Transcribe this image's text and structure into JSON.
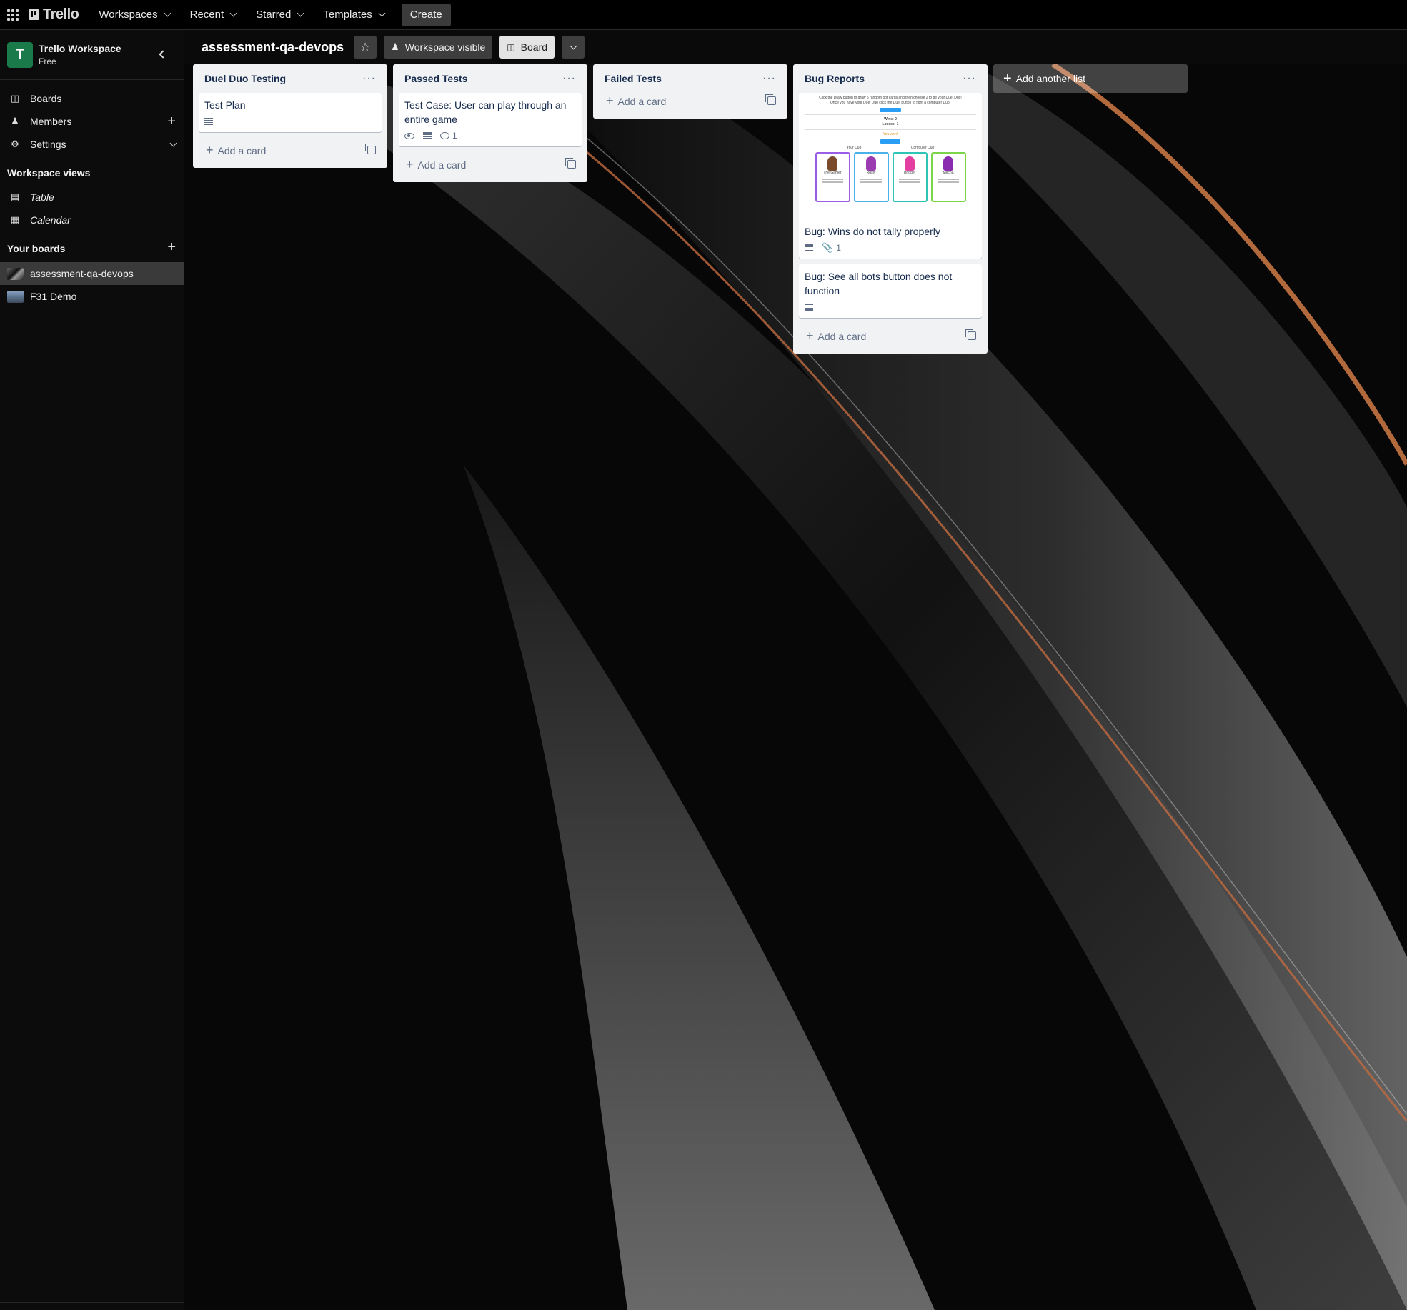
{
  "topnav": {
    "logo": "Trello",
    "items": [
      "Workspaces",
      "Recent",
      "Starred",
      "Templates"
    ],
    "create": "Create"
  },
  "sidebar": {
    "workspace": {
      "initial": "T",
      "name": "Trello Workspace",
      "plan": "Free"
    },
    "nav": [
      "Boards",
      "Members",
      "Settings"
    ],
    "views_heading": "Workspace views",
    "views": [
      "Table",
      "Calendar"
    ],
    "boards_heading": "Your boards",
    "boards": [
      "assessment-qa-devops",
      "F31 Demo"
    ]
  },
  "board": {
    "title": "assessment-qa-devops",
    "visibility": "Workspace visible",
    "view": "Board"
  },
  "lists": [
    {
      "title": "Duel Duo Testing",
      "cards": [
        {
          "title": "Test Plan"
        }
      ],
      "add_card": "Add a card"
    },
    {
      "title": "Passed Tests",
      "cards": [
        {
          "title": "Test Case: User can play through an entire game",
          "comments": "1"
        }
      ],
      "add_card": "Add a card"
    },
    {
      "title": "Failed Tests",
      "cards": [],
      "add_card": "Add a card"
    },
    {
      "title": "Bug Reports",
      "cards": [
        {
          "title": "Bug: Wins do not tally properly",
          "attachments": "1",
          "cover": {
            "line1": "Click the Draw button to draw 5 random bot cards and then choose 2 to be your Duel Duo!",
            "line2": "Once you have your Duel Duo click the Duel button to fight a computer Duo!",
            "button": "See All Bots",
            "wins": "Wins: 0",
            "losses": "Losses: 1",
            "result": "You won!",
            "again": "Play again",
            "your_duo": "Your Duo",
            "computer_duo": "Computer Duo",
            "bots": [
              "The Gamer",
              "Rusty",
              "Bridget",
              "Mecha"
            ]
          }
        },
        {
          "title": "Bug: See all bots button does not function"
        }
      ],
      "add_card": "Add a card"
    }
  ],
  "add_list": "Add another list",
  "colors": {
    "workspace_avatar": "#1a7a4a",
    "list_bg": "#f1f2f4",
    "title_text": "#172b4d"
  }
}
